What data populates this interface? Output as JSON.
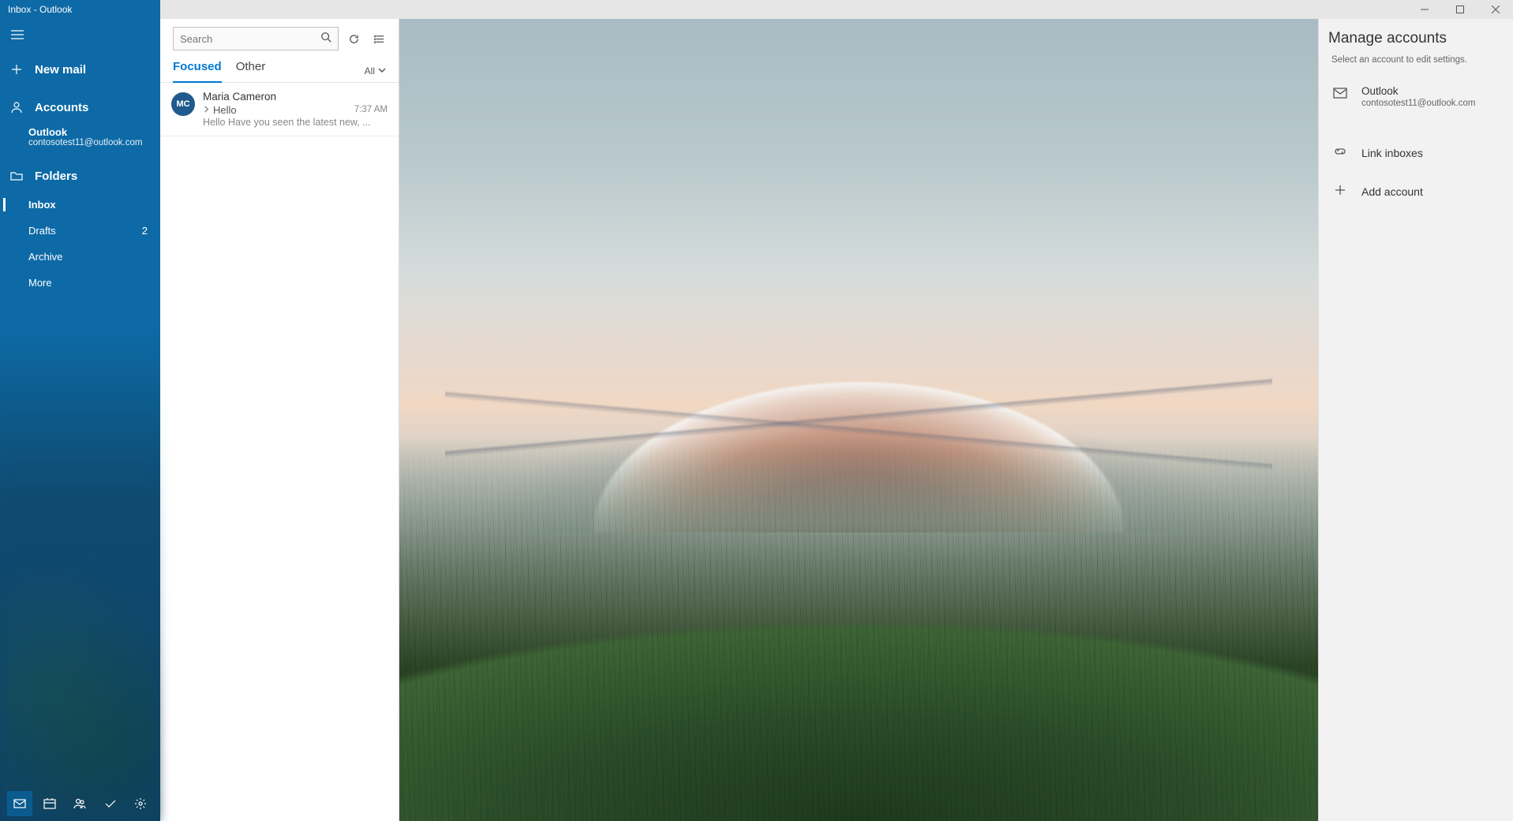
{
  "window": {
    "title": "Inbox - Outlook"
  },
  "sidebar": {
    "new_mail": "New mail",
    "accounts_header": "Accounts",
    "account": {
      "name": "Outlook",
      "email": "contosotest11@outlook.com"
    },
    "folders_header": "Folders",
    "folders": [
      {
        "label": "Inbox",
        "count": "",
        "selected": true
      },
      {
        "label": "Drafts",
        "count": "2",
        "selected": false
      },
      {
        "label": "Archive",
        "count": "",
        "selected": false
      },
      {
        "label": "More",
        "count": "",
        "selected": false
      }
    ]
  },
  "list": {
    "search_placeholder": "Search",
    "tabs": {
      "focused": "Focused",
      "other": "Other"
    },
    "filter_label": "All",
    "mail": {
      "initials": "MC",
      "from": "Maria Cameron",
      "subject": "Hello",
      "time": "7:37 AM",
      "preview": "Hello Have you seen the latest new, ..."
    }
  },
  "panel": {
    "title": "Manage accounts",
    "subtitle": "Select an account to edit settings.",
    "account": {
      "name": "Outlook",
      "email": "contosotest11@outlook.com"
    },
    "link_inboxes": "Link inboxes",
    "add_account": "Add account"
  }
}
